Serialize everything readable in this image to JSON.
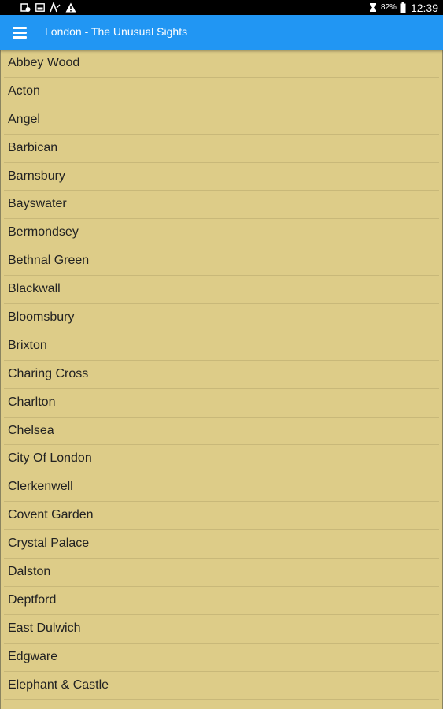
{
  "status_bar": {
    "icons": [
      "sync-icon",
      "image-icon",
      "signal-icon",
      "warning-icon"
    ],
    "right_icons": [
      "alarm-icon",
      "battery-icon"
    ],
    "battery": "82%",
    "time": "12:39"
  },
  "app_bar": {
    "menu_icon": "hamburger-menu-icon",
    "title": "London - The Unusual Sights",
    "color": "#2196f3"
  },
  "list": {
    "background": "#ddcc88",
    "items": [
      "Abbey Wood",
      "Acton",
      "Angel",
      "Barbican",
      "Barnsbury",
      "Bayswater",
      "Bermondsey",
      "Bethnal Green",
      "Blackwall",
      "Bloomsbury",
      "Brixton",
      "Charing Cross",
      "Charlton",
      "Chelsea",
      "City Of London",
      "Clerkenwell",
      "Covent Garden",
      "Crystal Palace",
      "Dalston",
      "Deptford",
      "East Dulwich",
      "Edgware",
      "Elephant & Castle"
    ]
  }
}
